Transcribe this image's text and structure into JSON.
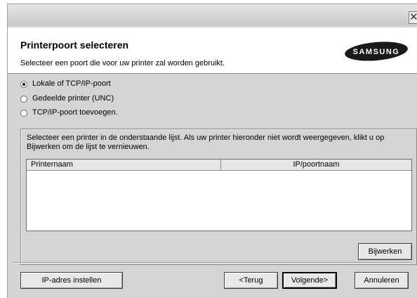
{
  "window": {
    "close_glyph": "✕"
  },
  "header": {
    "title": "Printerpoort selecteren",
    "subtitle": "Selecteer een poort die voor uw printer zal worden gebruikt.",
    "logo_text": "SAMSUNG"
  },
  "port_options": [
    {
      "label": "Lokale of TCP/IP-poort",
      "checked": true
    },
    {
      "label": "Gedeelde printer (UNC)",
      "checked": false
    },
    {
      "label": "TCP/IP-poort toevoegen.",
      "checked": false
    }
  ],
  "printer_list": {
    "instructions": "Selecteer een printer in de onderstaande lijst. Als uw printer hieronder niet wordt weergegeven, klikt u op Bijwerken om de lijst te vernieuwen.",
    "columns": [
      "Printernaam",
      "IP/poortnaam"
    ],
    "rows": [],
    "refresh_label": "Bijwerken"
  },
  "footer": {
    "set_ip_label": "IP-adres instellen",
    "back_label": "<Terug",
    "next_label": "Volgende>",
    "cancel_label": "Annuleren"
  },
  "colors": {
    "dialog_bg": "#d4d4d4",
    "header_bg": "#ffffff",
    "logo_bg": "#1a1a1a"
  }
}
